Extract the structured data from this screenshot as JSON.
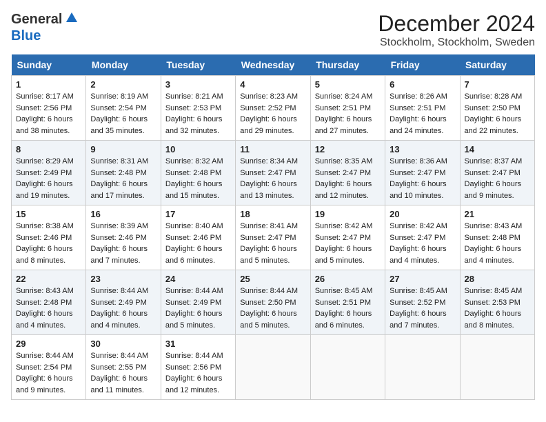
{
  "header": {
    "logo_general": "General",
    "logo_blue": "Blue",
    "month": "December 2024",
    "location": "Stockholm, Stockholm, Sweden"
  },
  "weekdays": [
    "Sunday",
    "Monday",
    "Tuesday",
    "Wednesday",
    "Thursday",
    "Friday",
    "Saturday"
  ],
  "weeks": [
    [
      {
        "day": "1",
        "sunrise": "8:17 AM",
        "sunset": "2:56 PM",
        "daylight": "6 hours and 38 minutes."
      },
      {
        "day": "2",
        "sunrise": "8:19 AM",
        "sunset": "2:54 PM",
        "daylight": "6 hours and 35 minutes."
      },
      {
        "day": "3",
        "sunrise": "8:21 AM",
        "sunset": "2:53 PM",
        "daylight": "6 hours and 32 minutes."
      },
      {
        "day": "4",
        "sunrise": "8:23 AM",
        "sunset": "2:52 PM",
        "daylight": "6 hours and 29 minutes."
      },
      {
        "day": "5",
        "sunrise": "8:24 AM",
        "sunset": "2:51 PM",
        "daylight": "6 hours and 27 minutes."
      },
      {
        "day": "6",
        "sunrise": "8:26 AM",
        "sunset": "2:51 PM",
        "daylight": "6 hours and 24 minutes."
      },
      {
        "day": "7",
        "sunrise": "8:28 AM",
        "sunset": "2:50 PM",
        "daylight": "6 hours and 22 minutes."
      }
    ],
    [
      {
        "day": "8",
        "sunrise": "8:29 AM",
        "sunset": "2:49 PM",
        "daylight": "6 hours and 19 minutes."
      },
      {
        "day": "9",
        "sunrise": "8:31 AM",
        "sunset": "2:48 PM",
        "daylight": "6 hours and 17 minutes."
      },
      {
        "day": "10",
        "sunrise": "8:32 AM",
        "sunset": "2:48 PM",
        "daylight": "6 hours and 15 minutes."
      },
      {
        "day": "11",
        "sunrise": "8:34 AM",
        "sunset": "2:47 PM",
        "daylight": "6 hours and 13 minutes."
      },
      {
        "day": "12",
        "sunrise": "8:35 AM",
        "sunset": "2:47 PM",
        "daylight": "6 hours and 12 minutes."
      },
      {
        "day": "13",
        "sunrise": "8:36 AM",
        "sunset": "2:47 PM",
        "daylight": "6 hours and 10 minutes."
      },
      {
        "day": "14",
        "sunrise": "8:37 AM",
        "sunset": "2:47 PM",
        "daylight": "6 hours and 9 minutes."
      }
    ],
    [
      {
        "day": "15",
        "sunrise": "8:38 AM",
        "sunset": "2:46 PM",
        "daylight": "6 hours and 8 minutes."
      },
      {
        "day": "16",
        "sunrise": "8:39 AM",
        "sunset": "2:46 PM",
        "daylight": "6 hours and 7 minutes."
      },
      {
        "day": "17",
        "sunrise": "8:40 AM",
        "sunset": "2:46 PM",
        "daylight": "6 hours and 6 minutes."
      },
      {
        "day": "18",
        "sunrise": "8:41 AM",
        "sunset": "2:47 PM",
        "daylight": "6 hours and 5 minutes."
      },
      {
        "day": "19",
        "sunrise": "8:42 AM",
        "sunset": "2:47 PM",
        "daylight": "6 hours and 5 minutes."
      },
      {
        "day": "20",
        "sunrise": "8:42 AM",
        "sunset": "2:47 PM",
        "daylight": "6 hours and 4 minutes."
      },
      {
        "day": "21",
        "sunrise": "8:43 AM",
        "sunset": "2:48 PM",
        "daylight": "6 hours and 4 minutes."
      }
    ],
    [
      {
        "day": "22",
        "sunrise": "8:43 AM",
        "sunset": "2:48 PM",
        "daylight": "6 hours and 4 minutes."
      },
      {
        "day": "23",
        "sunrise": "8:44 AM",
        "sunset": "2:49 PM",
        "daylight": "6 hours and 4 minutes."
      },
      {
        "day": "24",
        "sunrise": "8:44 AM",
        "sunset": "2:49 PM",
        "daylight": "6 hours and 5 minutes."
      },
      {
        "day": "25",
        "sunrise": "8:44 AM",
        "sunset": "2:50 PM",
        "daylight": "6 hours and 5 minutes."
      },
      {
        "day": "26",
        "sunrise": "8:45 AM",
        "sunset": "2:51 PM",
        "daylight": "6 hours and 6 minutes."
      },
      {
        "day": "27",
        "sunrise": "8:45 AM",
        "sunset": "2:52 PM",
        "daylight": "6 hours and 7 minutes."
      },
      {
        "day": "28",
        "sunrise": "8:45 AM",
        "sunset": "2:53 PM",
        "daylight": "6 hours and 8 minutes."
      }
    ],
    [
      {
        "day": "29",
        "sunrise": "8:44 AM",
        "sunset": "2:54 PM",
        "daylight": "6 hours and 9 minutes."
      },
      {
        "day": "30",
        "sunrise": "8:44 AM",
        "sunset": "2:55 PM",
        "daylight": "6 hours and 11 minutes."
      },
      {
        "day": "31",
        "sunrise": "8:44 AM",
        "sunset": "2:56 PM",
        "daylight": "6 hours and 12 minutes."
      },
      null,
      null,
      null,
      null
    ]
  ],
  "labels": {
    "sunrise": "Sunrise:",
    "sunset": "Sunset:",
    "daylight": "Daylight:"
  }
}
